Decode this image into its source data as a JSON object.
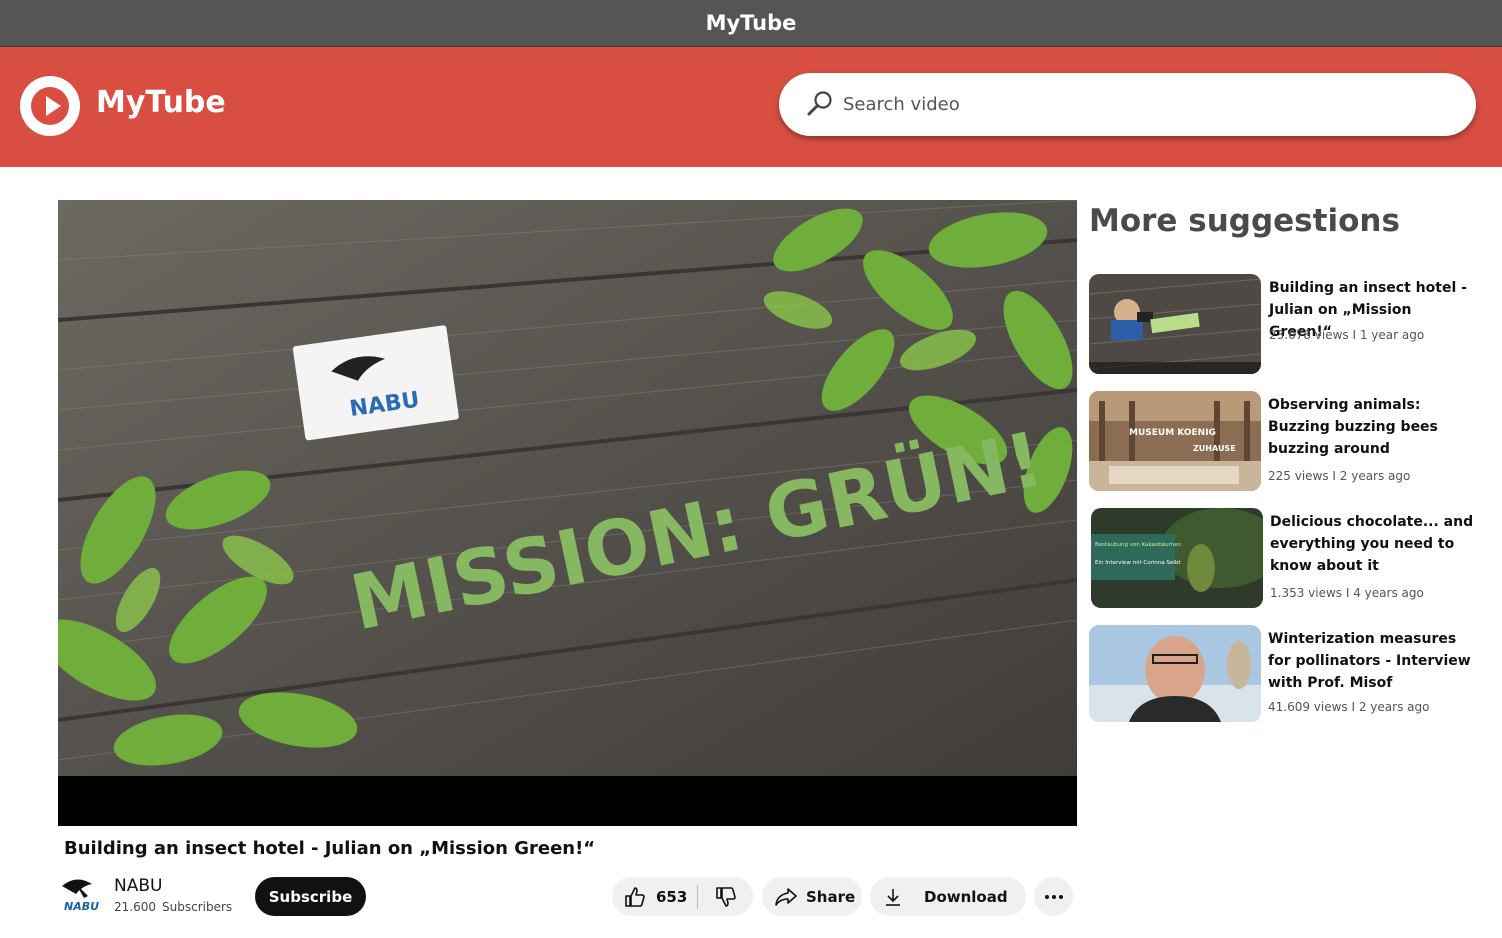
{
  "window": {
    "title": "MyTube"
  },
  "header": {
    "brand": "MyTube",
    "search_placeholder": "Search video"
  },
  "player": {
    "overlay_logo_text": "NABU",
    "overlay_title_text": "MISSION: GRÜN!"
  },
  "video": {
    "title": "Building an insect hotel - Julian on „Mission Green!“",
    "channel": {
      "name": "NABU",
      "subscriber_count": "21.600",
      "subscriber_label": "Subscribers",
      "logo_text": "NABU"
    },
    "subscribe_label": "Subscribe",
    "likes": "653",
    "share_label": "Share",
    "download_label": "Download"
  },
  "suggestions": {
    "heading": "More suggestions",
    "items": [
      {
        "title": "Building an insect hotel - Julian on „Mission Green!“",
        "meta": "23.078 views I 1 year ago"
      },
      {
        "title": "Observing animals: Buzzing buzzing bees buzzing around",
        "meta": "225 views I 2 years ago",
        "thumb_text_1": "MUSEUM KOENIG",
        "thumb_text_2": "ZUHAUSE"
      },
      {
        "title": "Delicious chocolate... and everything you need to know about it",
        "meta": "1.353  views I 4 years ago",
        "thumb_text_1": "Bestäubung von Kakaobäumen",
        "thumb_text_2": "Ein Interview mit Corinna Seibt"
      },
      {
        "title": "Winterization measures for pollinators - Interview with Prof. Misof",
        "meta": "41.609 views I 2 years ago"
      }
    ]
  },
  "colors": {
    "header_red": "#d84f42",
    "titlebar_gray": "#555555",
    "text_dark": "#111111"
  },
  "icons": [
    "play-logo-icon",
    "search-icon",
    "thumbs-up-icon",
    "thumbs-down-icon",
    "share-icon",
    "download-icon",
    "more-options-icon"
  ]
}
